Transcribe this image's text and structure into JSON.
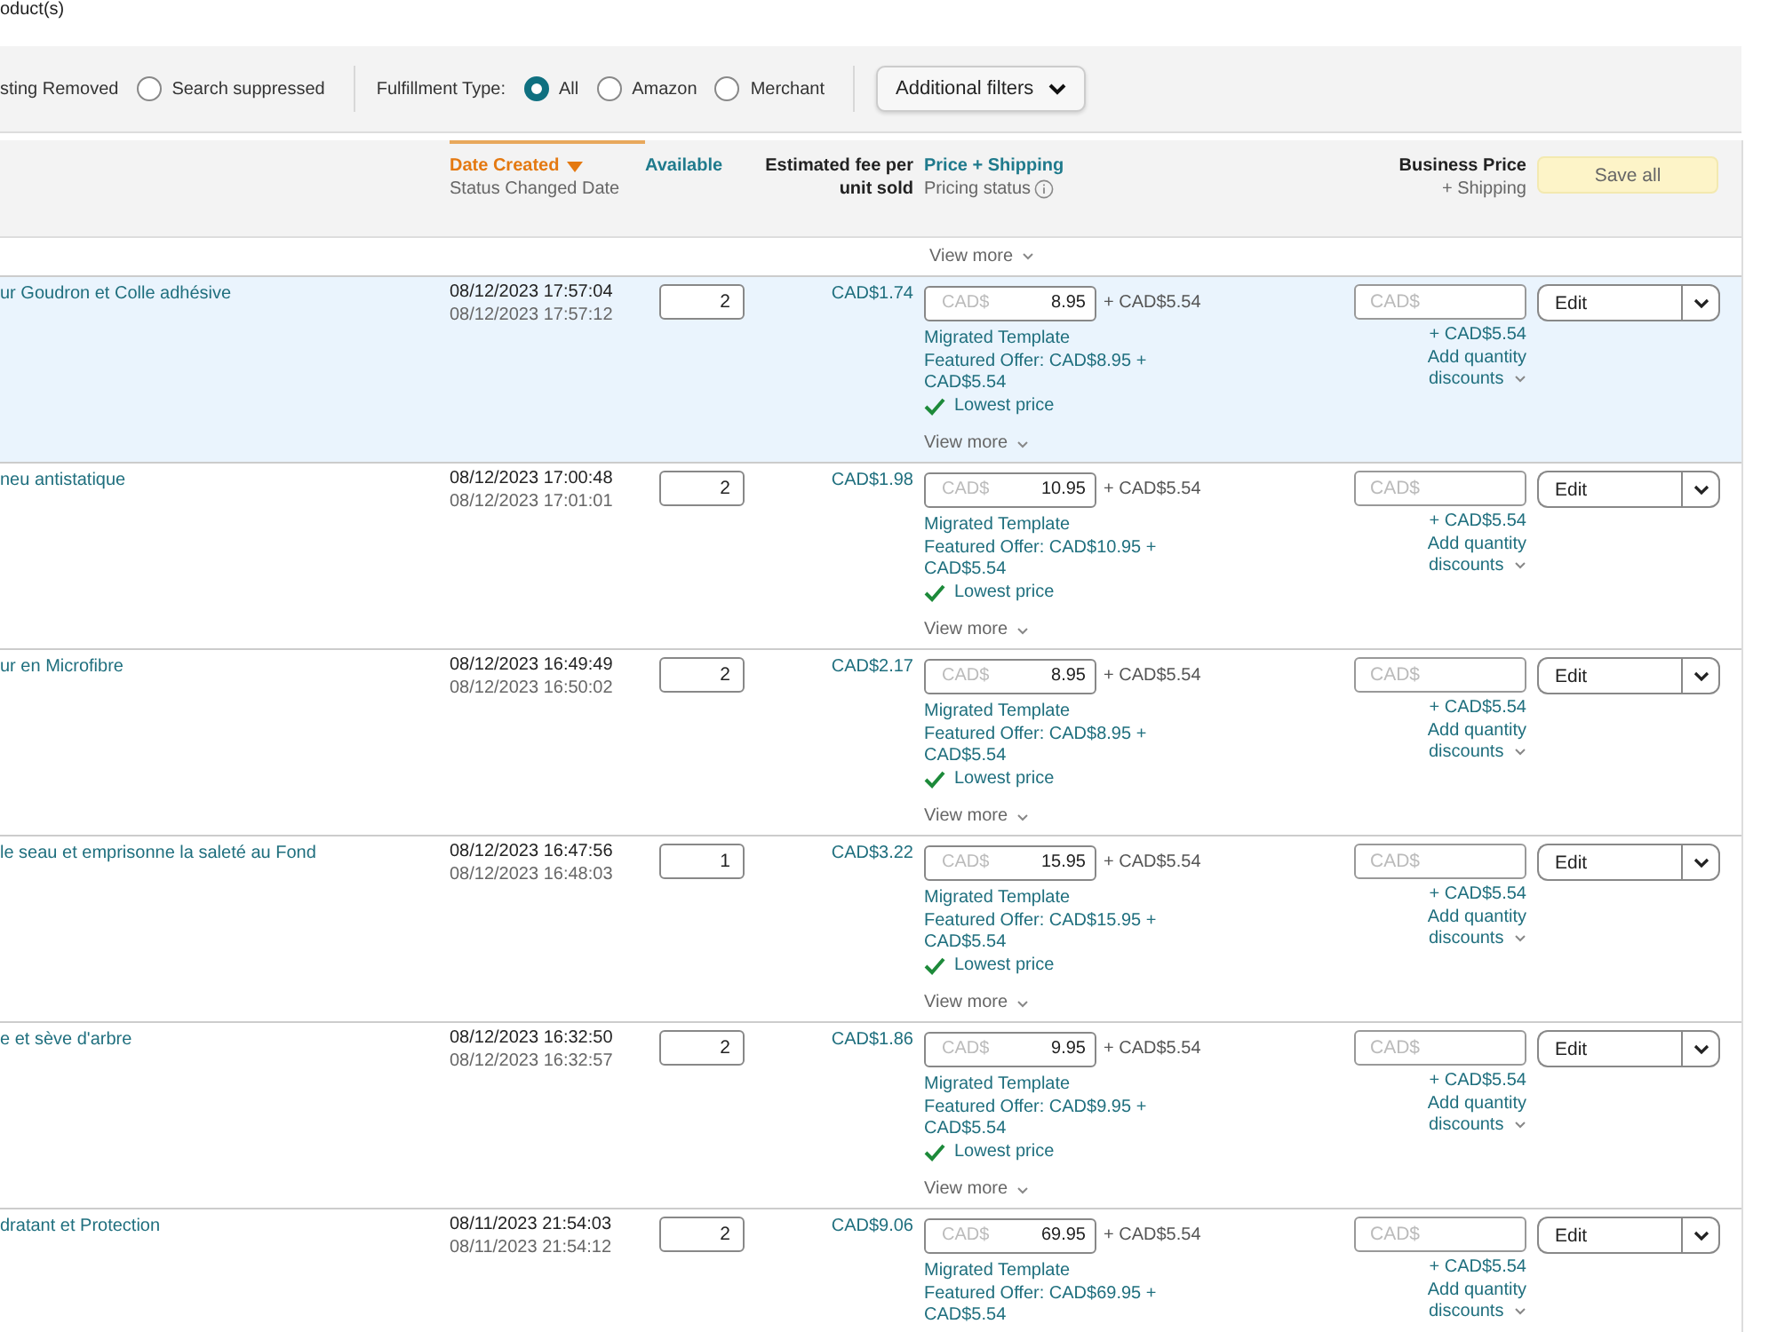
{
  "page_heading": "oduct(s)",
  "filters": {
    "status": [
      {
        "kind": "cut",
        "label": "sting Removed"
      },
      {
        "kind": "radio",
        "label": "Search suppressed",
        "selected": false
      }
    ],
    "fulfillment": {
      "label": "Fulfillment Type:",
      "options": [
        {
          "label": "All",
          "selected": true
        },
        {
          "label": "Amazon",
          "selected": false
        },
        {
          "label": "Merchant",
          "selected": false
        }
      ]
    },
    "additional_filters": "Additional filters"
  },
  "header": {
    "date": {
      "title": "Date Created",
      "sub": "Status Changed Date",
      "sorted": true
    },
    "available": "Available",
    "fee": "Estimated fee per unit sold",
    "price": {
      "title": "Price + Shipping",
      "sub": "Pricing status"
    },
    "business": {
      "title": "Business Price",
      "sub": "+ Shipping"
    },
    "save_all": "Save all"
  },
  "top_view_more": "View more",
  "rows": [
    {
      "selected": true,
      "name": "ur Goudron et Colle adhésive",
      "created": "08/12/2023 17:57:04",
      "changed": "08/12/2023 17:57:12",
      "available": "2",
      "fee": "CAD$1.74",
      "placeholder": "CAD$",
      "price": "8.95",
      "shipping": "+ CAD$5.54",
      "template": "Migrated Template",
      "featured": "Featured Offer: CAD$8.95 + CAD$5.54",
      "pricing_status": "Lowest price",
      "view_more": "View more",
      "business_placeholder": "CAD$",
      "business_shipping": "+ CAD$5.54",
      "discounts": "Add quantity discounts",
      "action": "Edit"
    },
    {
      "selected": false,
      "name": "neu antistatique",
      "created": "08/12/2023 17:00:48",
      "changed": "08/12/2023 17:01:01",
      "available": "2",
      "fee": "CAD$1.98",
      "placeholder": "CAD$",
      "price": "10.95",
      "shipping": "+ CAD$5.54",
      "template": "Migrated Template",
      "featured": "Featured Offer: CAD$10.95 + CAD$5.54",
      "pricing_status": "Lowest price",
      "view_more": "View more",
      "business_placeholder": "CAD$",
      "business_shipping": "+ CAD$5.54",
      "discounts": "Add quantity discounts",
      "action": "Edit"
    },
    {
      "selected": false,
      "name": "ur en Microfibre",
      "created": "08/12/2023 16:49:49",
      "changed": "08/12/2023 16:50:02",
      "available": "2",
      "fee": "CAD$2.17",
      "placeholder": "CAD$",
      "price": "8.95",
      "shipping": "+ CAD$5.54",
      "template": "Migrated Template",
      "featured": "Featured Offer: CAD$8.95 + CAD$5.54",
      "pricing_status": "Lowest price",
      "view_more": "View more",
      "business_placeholder": "CAD$",
      "business_shipping": "+ CAD$5.54",
      "discounts": "Add quantity discounts",
      "action": "Edit"
    },
    {
      "selected": false,
      "name": "le seau et emprisonne la saleté au Fond",
      "created": "08/12/2023 16:47:56",
      "changed": "08/12/2023 16:48:03",
      "available": "1",
      "fee": "CAD$3.22",
      "placeholder": "CAD$",
      "price": "15.95",
      "shipping": "+ CAD$5.54",
      "template": "Migrated Template",
      "featured": "Featured Offer: CAD$15.95 + CAD$5.54",
      "pricing_status": "Lowest price",
      "view_more": "View more",
      "business_placeholder": "CAD$",
      "business_shipping": "+ CAD$5.54",
      "discounts": "Add quantity discounts",
      "action": "Edit"
    },
    {
      "selected": false,
      "name": "e et sève d'arbre",
      "created": "08/12/2023 16:32:50",
      "changed": "08/12/2023 16:32:57",
      "available": "2",
      "fee": "CAD$1.86",
      "placeholder": "CAD$",
      "price": "9.95",
      "shipping": "+ CAD$5.54",
      "template": "Migrated Template",
      "featured": "Featured Offer: CAD$9.95 + CAD$5.54",
      "pricing_status": "Lowest price",
      "view_more": "View more",
      "business_placeholder": "CAD$",
      "business_shipping": "+ CAD$5.54",
      "discounts": "Add quantity discounts",
      "action": "Edit"
    },
    {
      "selected": false,
      "name": "dratant et Protection",
      "created": "08/11/2023 21:54:03",
      "changed": "08/11/2023 21:54:12",
      "available": "2",
      "fee": "CAD$9.06",
      "placeholder": "CAD$",
      "price": "69.95",
      "shipping": "+ CAD$5.54",
      "template": "Migrated Template",
      "featured": "Featured Offer: CAD$69.95 + CAD$5.54",
      "business_placeholder": "CAD$",
      "business_shipping": "+ CAD$5.54",
      "discounts": "Add quantity discounts",
      "action": "Edit"
    }
  ]
}
